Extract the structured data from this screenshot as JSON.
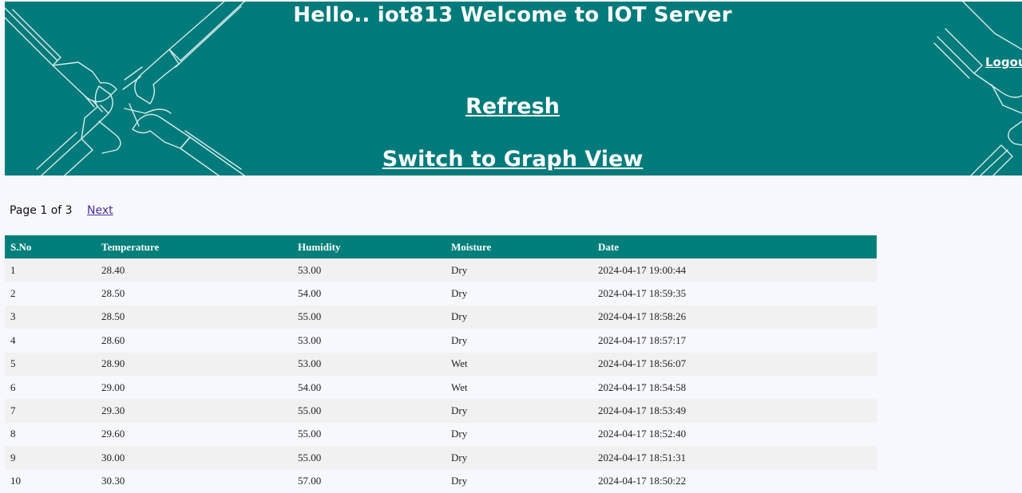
{
  "header": {
    "title": "Hello.. iot813 Welcome to IOT Server",
    "logout_label": "Logout",
    "refresh_label": "Refresh",
    "graph_view_label": "Switch to Graph View"
  },
  "pagination": {
    "status": "Page 1 of 3",
    "next_label": "Next"
  },
  "table": {
    "columns": [
      "S.No",
      "Temperature",
      "Humidity",
      "Moisture",
      "Date"
    ],
    "rows": [
      [
        "1",
        "28.40",
        "53.00",
        "Dry",
        "2024-04-17 19:00:44"
      ],
      [
        "2",
        "28.50",
        "54.00",
        "Dry",
        "2024-04-17 18:59:35"
      ],
      [
        "3",
        "28.50",
        "55.00",
        "Dry",
        "2024-04-17 18:58:26"
      ],
      [
        "4",
        "28.60",
        "53.00",
        "Dry",
        "2024-04-17 18:57:17"
      ],
      [
        "5",
        "28.90",
        "53.00",
        "Wet",
        "2024-04-17 18:56:07"
      ],
      [
        "6",
        "29.00",
        "54.00",
        "Wet",
        "2024-04-17 18:54:58"
      ],
      [
        "7",
        "29.30",
        "55.00",
        "Dry",
        "2024-04-17 18:53:49"
      ],
      [
        "8",
        "29.60",
        "55.00",
        "Dry",
        "2024-04-17 18:52:40"
      ],
      [
        "9",
        "30.00",
        "55.00",
        "Dry",
        "2024-04-17 18:51:31"
      ],
      [
        "10",
        "30.30",
        "57.00",
        "Dry",
        "2024-04-17 18:50:22"
      ]
    ]
  },
  "colors": {
    "banner": "#007a7a",
    "table_header": "#007f7a",
    "link_visited": "#4b2ea0"
  }
}
